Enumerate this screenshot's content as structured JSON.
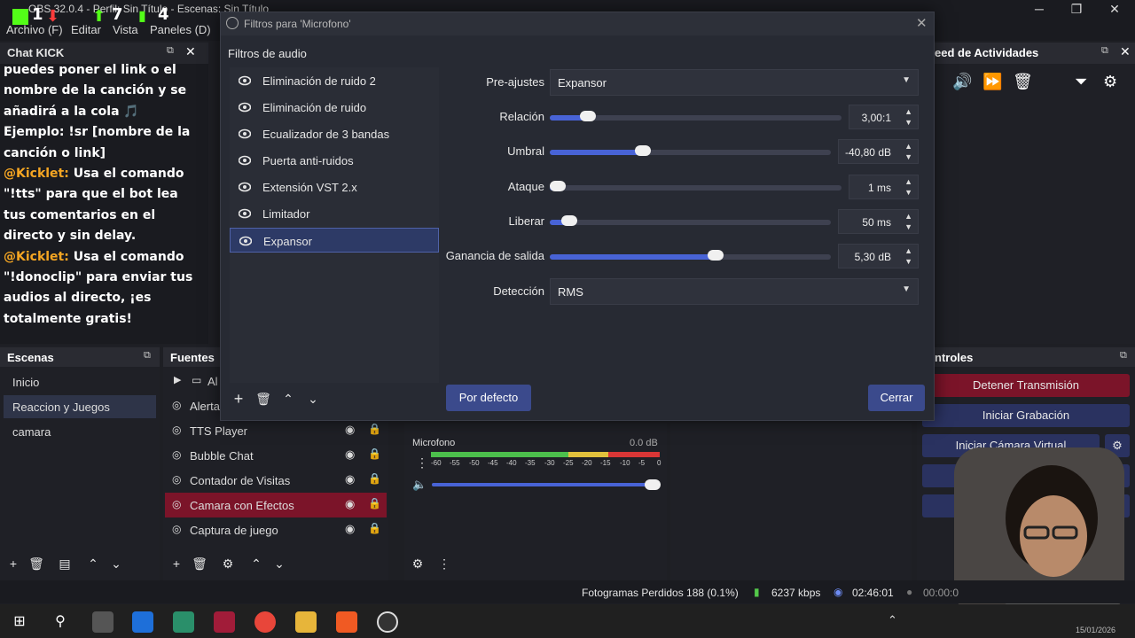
{
  "obs": {
    "title": "OBS 32.0.4 - Perfil: Sin Título - Escenas: Sin Título",
    "menu": [
      "Archivo (F)",
      "Editar",
      "Vista",
      "Paneles (D)"
    ]
  },
  "stats_overlay": {
    "kick_count": "1",
    "up_count": "7",
    "bars_count": "4"
  },
  "chat": {
    "title": "Chat KICK",
    "lines": [
      "puedes poner el link o el nombre de la canción y se añadirá a la cola 🎵 Ejemplo: !sr [nombre de la canción o link]",
      "Usa el comando \"!tts\" para que el bot lea tus comentarios en el directo y sin delay.",
      "Usa el comando \"!donoclip\" para enviar tus audios al directo, ¡es totalmente gratis!"
    ],
    "user": "@Kicklet:"
  },
  "activity_feed": {
    "title": "eed de Actividades"
  },
  "dialog": {
    "title": "Filtros para 'Microfono'",
    "filters_label": "Filtros de audio",
    "filters": [
      "Eliminación de ruido 2",
      "Eliminación de ruido",
      "Ecualizador de 3 bandas",
      "Puerta anti-ruidos",
      "Extensión VST 2.x",
      "Limitador",
      "Expansor"
    ],
    "selected_filter": "Expansor",
    "preset_label": "Pre-ajustes",
    "preset_value": "Expansor",
    "props": [
      {
        "label": "Relación",
        "value": "3,00:1",
        "fraction": 0.13
      },
      {
        "label": "Umbral",
        "value": "-40,80 dB",
        "fraction": 0.33
      },
      {
        "label": "Ataque",
        "value": "1 ms",
        "fraction": 0.02
      },
      {
        "label": "Liberar",
        "value": "50 ms",
        "fraction": 0.07
      },
      {
        "label": "Ganancia de salida",
        "value": "5,30 dB",
        "fraction": 0.59
      }
    ],
    "detection_label": "Detección",
    "detection_value": "RMS",
    "default_button": "Por defecto",
    "close_button": "Cerrar"
  },
  "scenes": {
    "title": "Escenas",
    "items": [
      "Inicio",
      "Reaccion y Juegos",
      "camara"
    ],
    "selected": "Reaccion y Juegos"
  },
  "sources": {
    "title": "Fuentes",
    "items": [
      "Al",
      "Alerta",
      "TTS Player",
      "Bubble Chat",
      "Contador de Visitas",
      "Camara con Efectos",
      "Captura de juego"
    ],
    "selected": "Camara con Efectos"
  },
  "mixer": {
    "channel": "Microfono",
    "level": "0.0 dB",
    "scale": [
      "-60",
      "-55",
      "-50",
      "-45",
      "-40",
      "-35",
      "-30",
      "-25",
      "-20",
      "-15",
      "-10",
      "-5",
      "0"
    ]
  },
  "controls": {
    "title": "ntroles",
    "buttons": [
      "Detener Transmisión",
      "Iniciar Grabación",
      "Iniciar Cámara Virtual"
    ]
  },
  "status": {
    "frames": "Fotogramas Perdidos 188 (0.1%)",
    "bitrate": "6237 kbps",
    "stream_time": "02:46:01",
    "rec_time": "00:00:0"
  },
  "taskbar_date": "15/01/2026"
}
